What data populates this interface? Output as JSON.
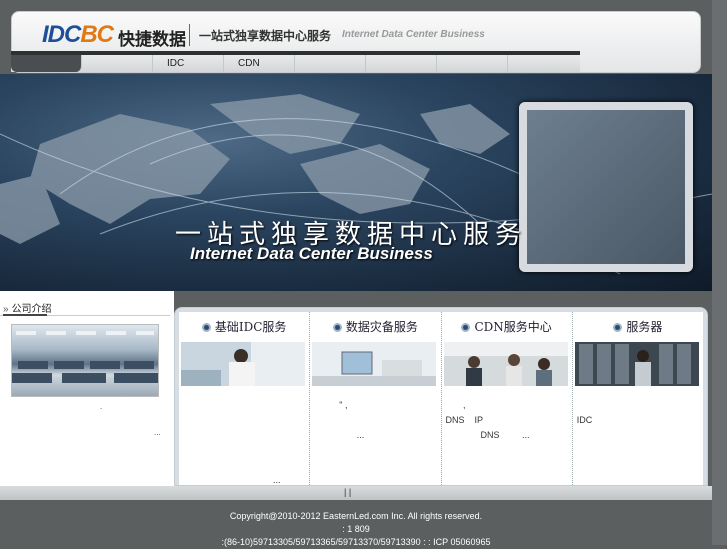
{
  "header": {
    "logo_idc": "IDC",
    "logo_bc": "BC",
    "brand_cn": "快捷数据",
    "slogan_cn": "一站式独享数据中心服务",
    "slogan_en": "Internet Data Center Business"
  },
  "nav": {
    "items": [
      "",
      "",
      "IDC",
      "CDN",
      "",
      "",
      "",
      ""
    ]
  },
  "banner": {
    "title_cn": "一站式独享数据中心服务",
    "title_en": "Internet Data Center Business"
  },
  "left": {
    "section_title": "公司介绍",
    "section_mark": "»",
    "dot1": ".",
    "dot2": "..."
  },
  "services": [
    {
      "title": "基础IDC服务",
      "text": "\n\n\n\n\n                                    ..."
    },
    {
      "title": "数据灾备服务",
      "text": "          \" ,\n\n                 ..."
    },
    {
      "title": "CDN服务中心",
      "text": "       ,\nDNS    IP\n              DNS         ..."
    },
    {
      "title": "服务器",
      "text": "\nIDC"
    }
  ],
  "bottombar": {
    "text": "|     |"
  },
  "footer": {
    "copyright": "Copyright@2010-2012 EasternLed.com Inc. All rights reserved.",
    "line2": ":                    1   809",
    "line3": ":(86-10)59713305/59713365/59713370/59713390   :     : ICP 05060965"
  }
}
